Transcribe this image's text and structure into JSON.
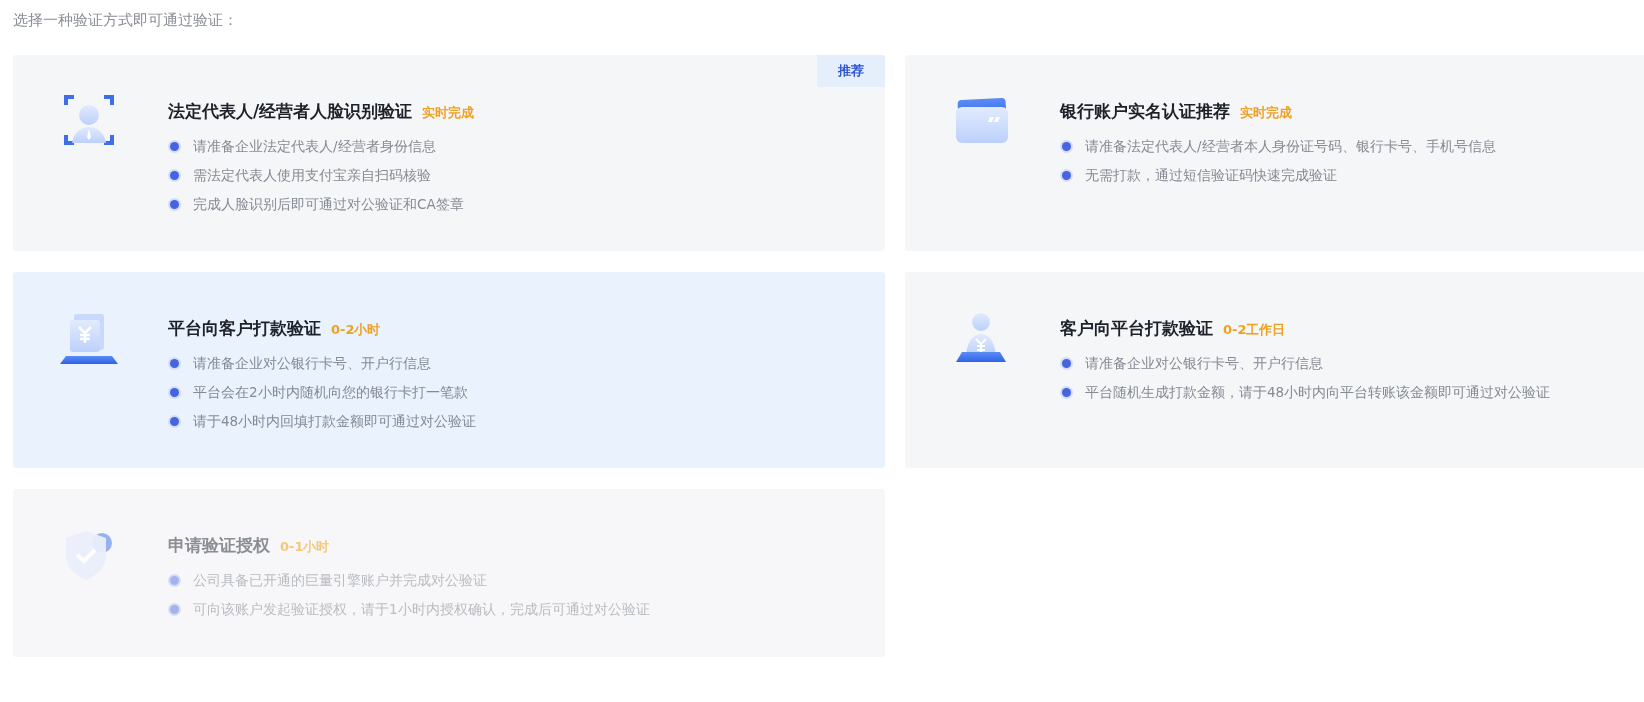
{
  "prompt": "选择一种验证方式即可通过验证：",
  "methods": [
    {
      "kind": "face",
      "title": "法定代表人/经营者人脸识别验证",
      "duration": "实时完成",
      "badge": "推荐",
      "selected": false,
      "disabled": false,
      "bullets": [
        "请准备企业法定代表人/经营者身份信息",
        "需法定代表人使用支付宝亲自扫码核验",
        "完成人脸识别后即可通过对公验证和CA签章"
      ]
    },
    {
      "kind": "card",
      "title": "银行账户实名认证推荐",
      "duration": "实时完成",
      "selected": false,
      "disabled": false,
      "bullets": [
        "请准备法定代表人/经营者本人身份证号码、银行卡号、手机号信息",
        "无需打款，通过短信验证码快速完成验证"
      ]
    },
    {
      "kind": "cash",
      "title": "平台向客户打款验证",
      "duration": "0-2小时",
      "selected": true,
      "disabled": false,
      "bullets": [
        "请准备企业对公银行卡号、开户行信息",
        "平台会在2小时内随机向您的银行卡打一笔款",
        "请于48小时内回填打款金额即可通过对公验证"
      ]
    },
    {
      "kind": "person-cash",
      "title": "客户向平台打款验证",
      "duration": "0-2工作日",
      "selected": false,
      "disabled": false,
      "bullets": [
        "请准备企业对公银行卡号、开户行信息",
        "平台随机生成打款金额，请于48小时内向平台转账该金额即可通过对公验证"
      ]
    },
    {
      "kind": "shield",
      "title": "申请验证授权",
      "duration": "0-1小时",
      "selected": false,
      "disabled": true,
      "bullets": [
        "公司具备已开通的巨量引擎账户并完成对公验证",
        "可向该账户发起验证授权，请于1小时内授权确认，完成后可通过对公验证"
      ]
    }
  ]
}
